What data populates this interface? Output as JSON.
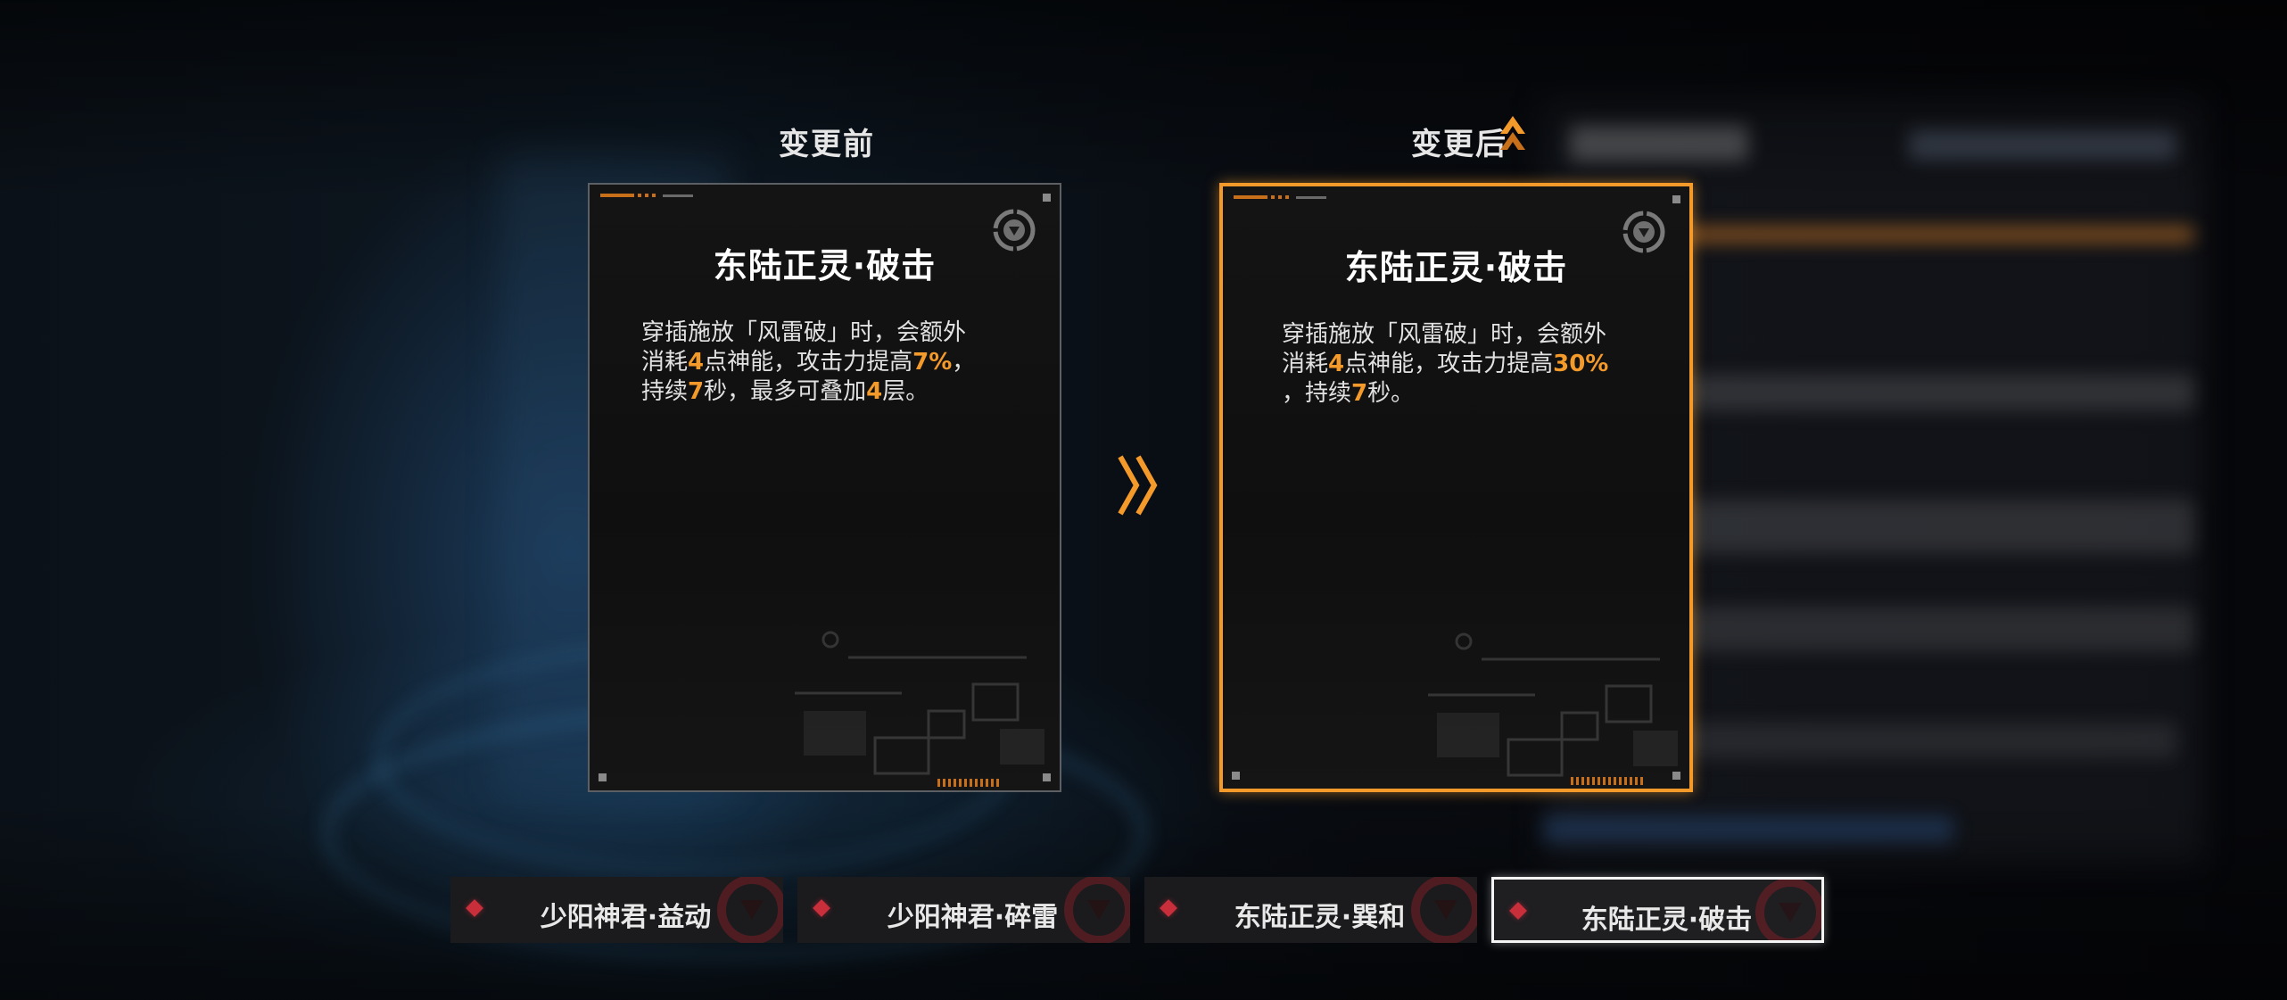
{
  "compare": {
    "before_label": "变更前",
    "after_label": "变更后"
  },
  "card_before": {
    "title": "东陆正灵·破击",
    "desc_parts": [
      "穿插施放「风雷破」时，会额外",
      "消耗",
      "4",
      "点神能，攻击力提高",
      "7%",
      "，",
      "持续",
      "7",
      "秒，最多可叠加",
      "4",
      "层。"
    ]
  },
  "card_after": {
    "title": "东陆正灵·破击",
    "desc_parts": [
      "穿插施放「风雷破」时，会额外",
      "消耗",
      "4",
      "点神能，攻击力提高",
      "30%",
      "，持续",
      "7",
      "秒。"
    ]
  },
  "tabs": [
    {
      "label": "少阳神君·益动",
      "active": false
    },
    {
      "label": "少阳神君·碎雷",
      "active": false
    },
    {
      "label": "东陆正灵·巽和",
      "active": false
    },
    {
      "label": "东陆正灵·破击",
      "active": true
    }
  ],
  "icons": {
    "compare_arrow": "double-chevron-right-icon",
    "after_marker": "chevron-up-icon",
    "emblem": "circle-triangle-emblem-icon",
    "tab_marker": "red-diamond-icon"
  },
  "colors": {
    "accent": "#f39a2b",
    "highlight_text": "#f39a2b",
    "tab_marker": "#c92f3a"
  }
}
